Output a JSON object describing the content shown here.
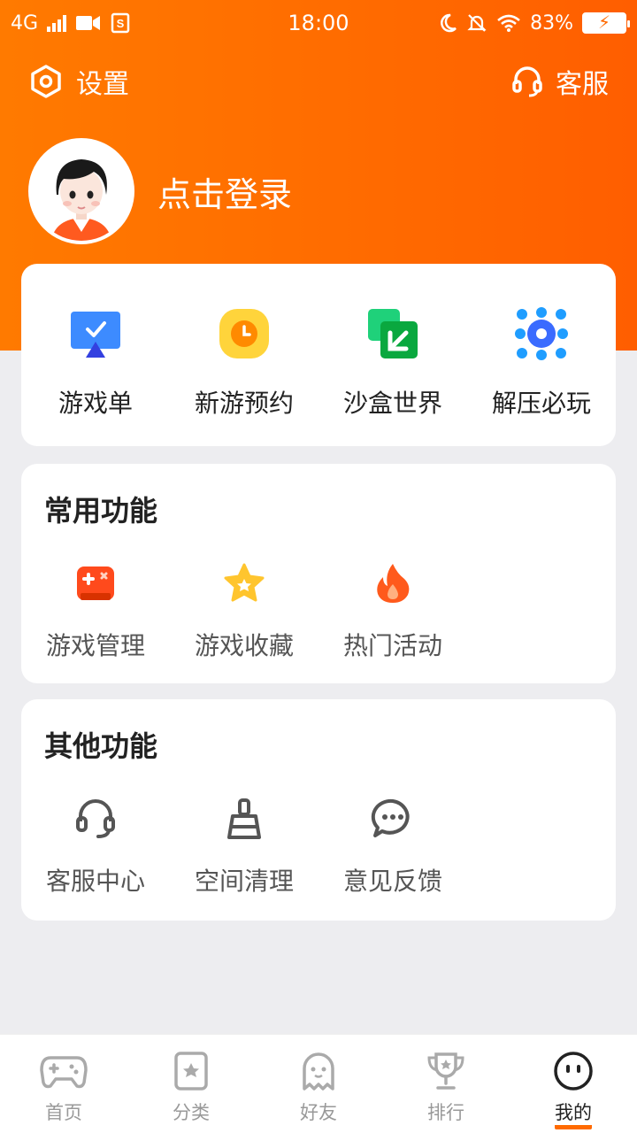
{
  "status_bar": {
    "network": "4G",
    "time": "18:00",
    "battery": "83%"
  },
  "topnav": {
    "settings_label": "设置",
    "service_label": "客服"
  },
  "profile": {
    "login_text": "点击登录"
  },
  "quick_entries": [
    {
      "label": "游戏单"
    },
    {
      "label": "新游预约"
    },
    {
      "label": "沙盒世界"
    },
    {
      "label": "解压必玩"
    }
  ],
  "common": {
    "title": "常用功能",
    "items": [
      {
        "label": "游戏管理"
      },
      {
        "label": "游戏收藏"
      },
      {
        "label": "热门活动"
      }
    ]
  },
  "other": {
    "title": "其他功能",
    "items": [
      {
        "label": "客服中心"
      },
      {
        "label": "空间清理"
      },
      {
        "label": "意见反馈"
      }
    ]
  },
  "tabbar": {
    "items": [
      {
        "label": "首页"
      },
      {
        "label": "分类"
      },
      {
        "label": "好友"
      },
      {
        "label": "排行"
      },
      {
        "label": "我的"
      }
    ]
  },
  "colors": {
    "accent": "#ff6a00",
    "background": "#ededf0"
  }
}
